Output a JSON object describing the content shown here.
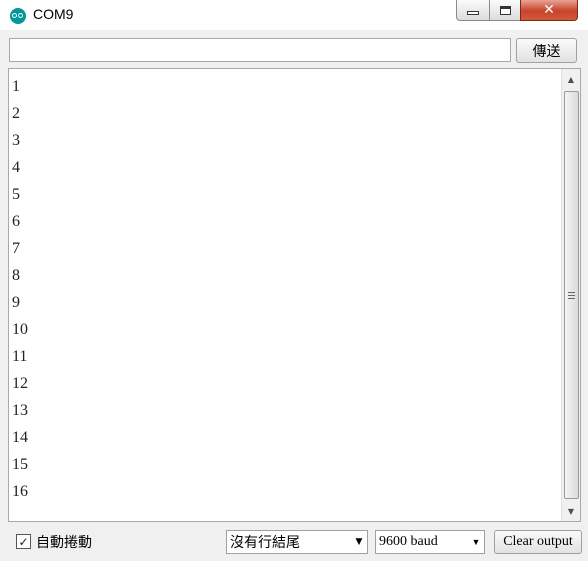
{
  "window": {
    "title": "COM9",
    "close_glyph": "✕"
  },
  "send": {
    "input_value": "",
    "button_label": "傳送"
  },
  "output": {
    "lines": [
      "1",
      "2",
      "3",
      "4",
      "5",
      "6",
      "7",
      "8",
      "9",
      "10",
      "11",
      "12",
      "13",
      "14",
      "15",
      "16"
    ]
  },
  "footer": {
    "autoscroll_label": "自動捲動",
    "autoscroll_checked": true,
    "check_glyph": "✓",
    "line_ending_value": "沒有行結尾",
    "baud_value": "9600 baud",
    "clear_label": "Clear output"
  },
  "icons": {
    "app": "arduino-icon",
    "dropdown": "chevron-down-icon"
  },
  "colors": {
    "accent": "#00979d",
    "close_button": "#c7432a"
  }
}
